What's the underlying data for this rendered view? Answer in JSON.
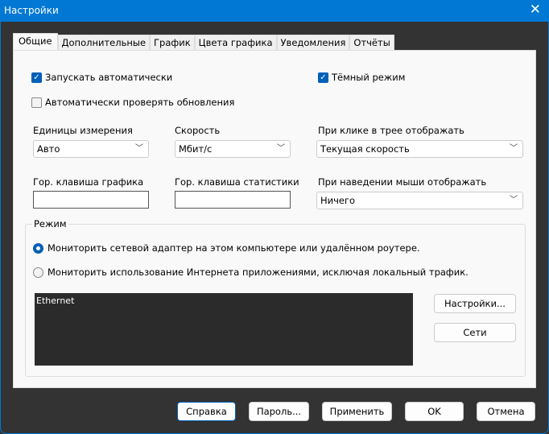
{
  "window": {
    "title": "Настройки",
    "close_icon": "close-icon"
  },
  "tabs": [
    "Общие",
    "Дополнительные",
    "График",
    "Цвета графика",
    "Уведомления",
    "Отчёты"
  ],
  "general": {
    "autostart": {
      "label": "Запускать автоматически",
      "checked": true
    },
    "dark_mode": {
      "label": "Тёмный режим",
      "checked": true
    },
    "auto_update": {
      "label": "Автоматически проверять обновления",
      "checked": false
    },
    "units": {
      "label": "Единицы измерения",
      "value": "Авто"
    },
    "speed": {
      "label": "Скорость",
      "value": "Мбит/с"
    },
    "tray_click": {
      "label": "При клике в трее отображать",
      "value": "Текущая скорость"
    },
    "graph_hotkey": {
      "label": "Гор. клавиша графика",
      "value": ""
    },
    "stats_hotkey": {
      "label": "Гор. клавиша статистики",
      "value": ""
    },
    "hover": {
      "label": "При наведении мыши отображать",
      "value": "Ничего"
    },
    "mode": {
      "label": "Режим",
      "option1": "Мониторить сетевой адаптер на этом компьютере или удалённом роутере.",
      "option2": "Мониторить использование Интернета приложениями, исключая локальный трафик.",
      "selected": 1
    },
    "adapters": [
      "Ethernet"
    ],
    "settings_button": "Настройки...",
    "networks_button": "Сети"
  },
  "footer": {
    "help": "Справка",
    "password": "Пароль...",
    "apply": "Применить",
    "ok": "OK",
    "cancel": "Отмена"
  }
}
